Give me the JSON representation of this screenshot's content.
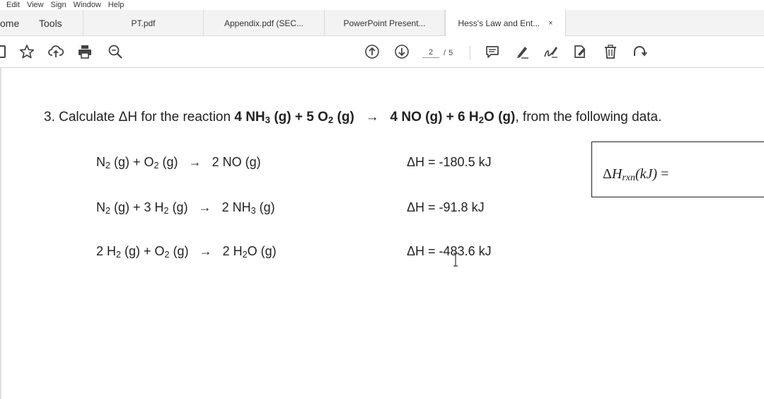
{
  "menu": [
    "Edit",
    "View",
    "Sign",
    "Window",
    "Help"
  ],
  "tabs": [
    {
      "label": "ome"
    },
    {
      "label": "Tools"
    },
    {
      "label": "PT.pdf"
    },
    {
      "label": "Appendix.pdf (SEC..."
    },
    {
      "label": "PowerPoint Present..."
    },
    {
      "label": "Hess's Law and Ent...",
      "active": true,
      "close": "×"
    }
  ],
  "toolbar": {
    "left_icons": [
      "bookmark-icon",
      "star-icon",
      "upload-cloud-icon",
      "print-icon",
      "zoom-search-icon"
    ],
    "page_current": "2",
    "page_separator": "/",
    "page_total": "5",
    "right_icons": [
      "comment-icon",
      "highlight-pen-icon",
      "sign-icon",
      "fill-sign-icon",
      "trash-icon",
      "rotate-icon"
    ]
  },
  "document": {
    "question_number": "3.",
    "question_prefix": "Calculate ΔH for the reaction",
    "reaction": {
      "r1_coef": "4 NH",
      "r1_sub": "3",
      "r1_state": " (g) + 5 O",
      "r2_sub": "2",
      "r2_state": " (g)",
      "arrow": "→",
      "p1": "4 NO (g) + 6 H",
      "p2_sub": "2",
      "p2_state": "O (g)"
    },
    "question_suffix": ", from the following data.",
    "equations": [
      {
        "parts": [
          "N",
          "2",
          " (g) + O",
          "2",
          " (g)"
        ],
        "arrow": "→",
        "product": [
          "2 NO (g)"
        ],
        "dh": "ΔH = -180.5 kJ"
      },
      {
        "parts": [
          "N",
          "2",
          " (g) + 3 H",
          "2",
          " (g)"
        ],
        "arrow": "→",
        "product": [
          "2 NH",
          "3",
          " (g)"
        ],
        "dh": "ΔH = -91.8 kJ"
      },
      {
        "parts": [
          "2 H",
          "2",
          " (g) + O",
          "2",
          " (g)"
        ],
        "arrow": "→",
        "product": [
          "2 H",
          "2",
          "O (g)"
        ],
        "dh": "ΔH = -483.6 kJ"
      }
    ],
    "answer_label": {
      "delta": "Δ",
      "H": "H",
      "sub": "rxn",
      "unit": "(kJ)",
      "eq": " ="
    }
  }
}
